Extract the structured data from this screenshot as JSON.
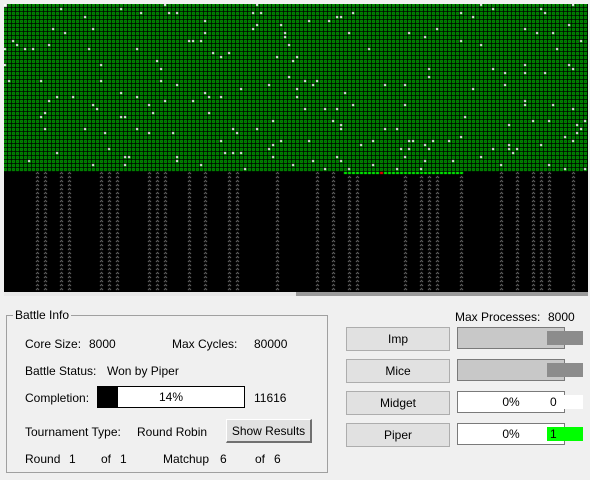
{
  "battle_info": {
    "title": "Battle Info",
    "core_size_label": "Core Size:",
    "core_size_value": "8000",
    "max_cycles_label": "Max Cycles:",
    "max_cycles_value": "80000",
    "battle_status_label": "Battle Status:",
    "battle_status_value": "Won by Piper",
    "completion_label": "Completion:",
    "completion_percent_text": "14%",
    "completion_fraction": 0.14,
    "cycles_value": "11616",
    "tournament_type_label": "Tournament Type:",
    "tournament_type_value": "Round Robin",
    "show_results_label": "Show Results",
    "round_label": "Round",
    "round_value": "1",
    "round_of_label": "of",
    "round_total": "1",
    "matchup_label": "Matchup",
    "matchup_value": "6",
    "matchup_of_label": "of",
    "matchup_total": "6"
  },
  "max_processes": {
    "label": "Max Processes:",
    "value": "8000"
  },
  "warriors": [
    {
      "name": "Imp",
      "process_text": "",
      "box_style": "grey",
      "count_text": "",
      "color": "#8c8c8c"
    },
    {
      "name": "Mice",
      "process_text": "",
      "box_style": "grey",
      "count_text": "",
      "color": "#8c8c8c"
    },
    {
      "name": "Midget",
      "process_text": "0%",
      "box_style": "white",
      "count_text": "0",
      "color": "#ffffff"
    },
    {
      "name": "Piper",
      "process_text": "0%",
      "box_style": "white",
      "count_text": "1",
      "color": "#00ff00"
    }
  ],
  "core_display": {
    "background": "#000000",
    "owned_color": "#00a000",
    "mark_color": "#ffffff",
    "highlight_color": "#ff0000",
    "owned_fraction": 0.59
  }
}
